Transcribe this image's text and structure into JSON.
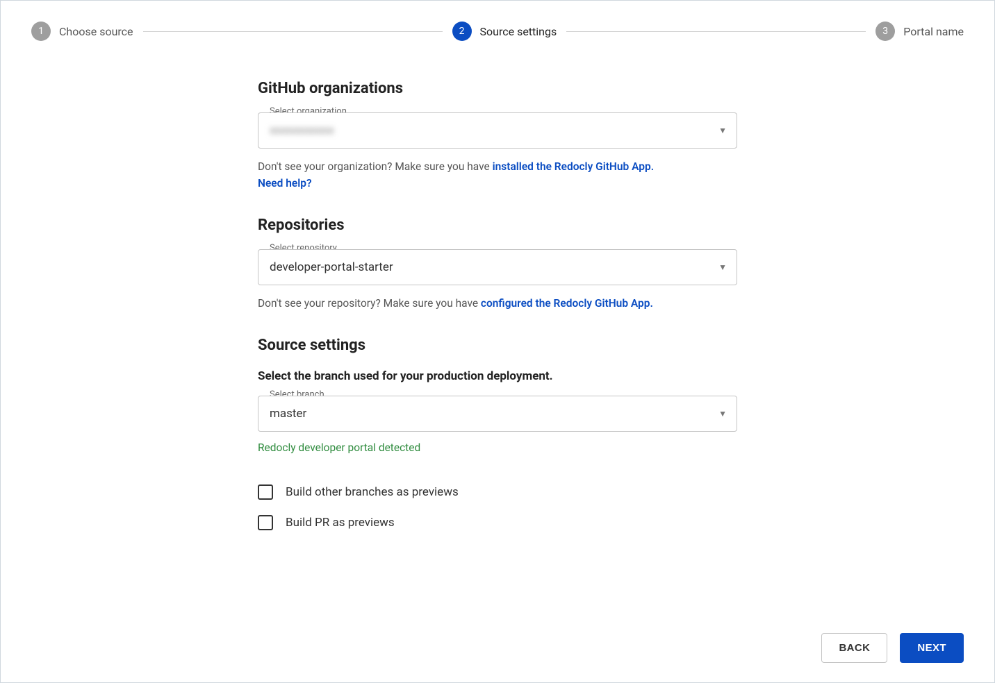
{
  "stepper": {
    "steps": [
      {
        "num": "1",
        "label": "Choose source",
        "state": "inactive"
      },
      {
        "num": "2",
        "label": "Source settings",
        "state": "active"
      },
      {
        "num": "3",
        "label": "Portal name",
        "state": "inactive"
      }
    ]
  },
  "org": {
    "heading": "GitHub organizations",
    "field_label": "Select organization",
    "value": "xxxxxxxxxxx",
    "helper_prefix": "Don't see your organization? Make sure you have ",
    "helper_link": "installed the Redocly GitHub App.",
    "helper_need_help": "Need help?"
  },
  "repo": {
    "heading": "Repositories",
    "field_label": "Select repository",
    "value": "developer-portal-starter",
    "helper_prefix": "Don't see your repository? Make sure you have ",
    "helper_link": "configured the Redocly GitHub App."
  },
  "source": {
    "heading": "Source settings",
    "sub_heading": "Select the branch used for your production deployment.",
    "field_label": "Select branch",
    "value": "master",
    "detected": "Redocly developer portal detected"
  },
  "checkboxes": {
    "build_branches": "Build other branches as previews",
    "build_pr": "Build PR as previews"
  },
  "buttons": {
    "back": "BACK",
    "next": "NEXT"
  }
}
